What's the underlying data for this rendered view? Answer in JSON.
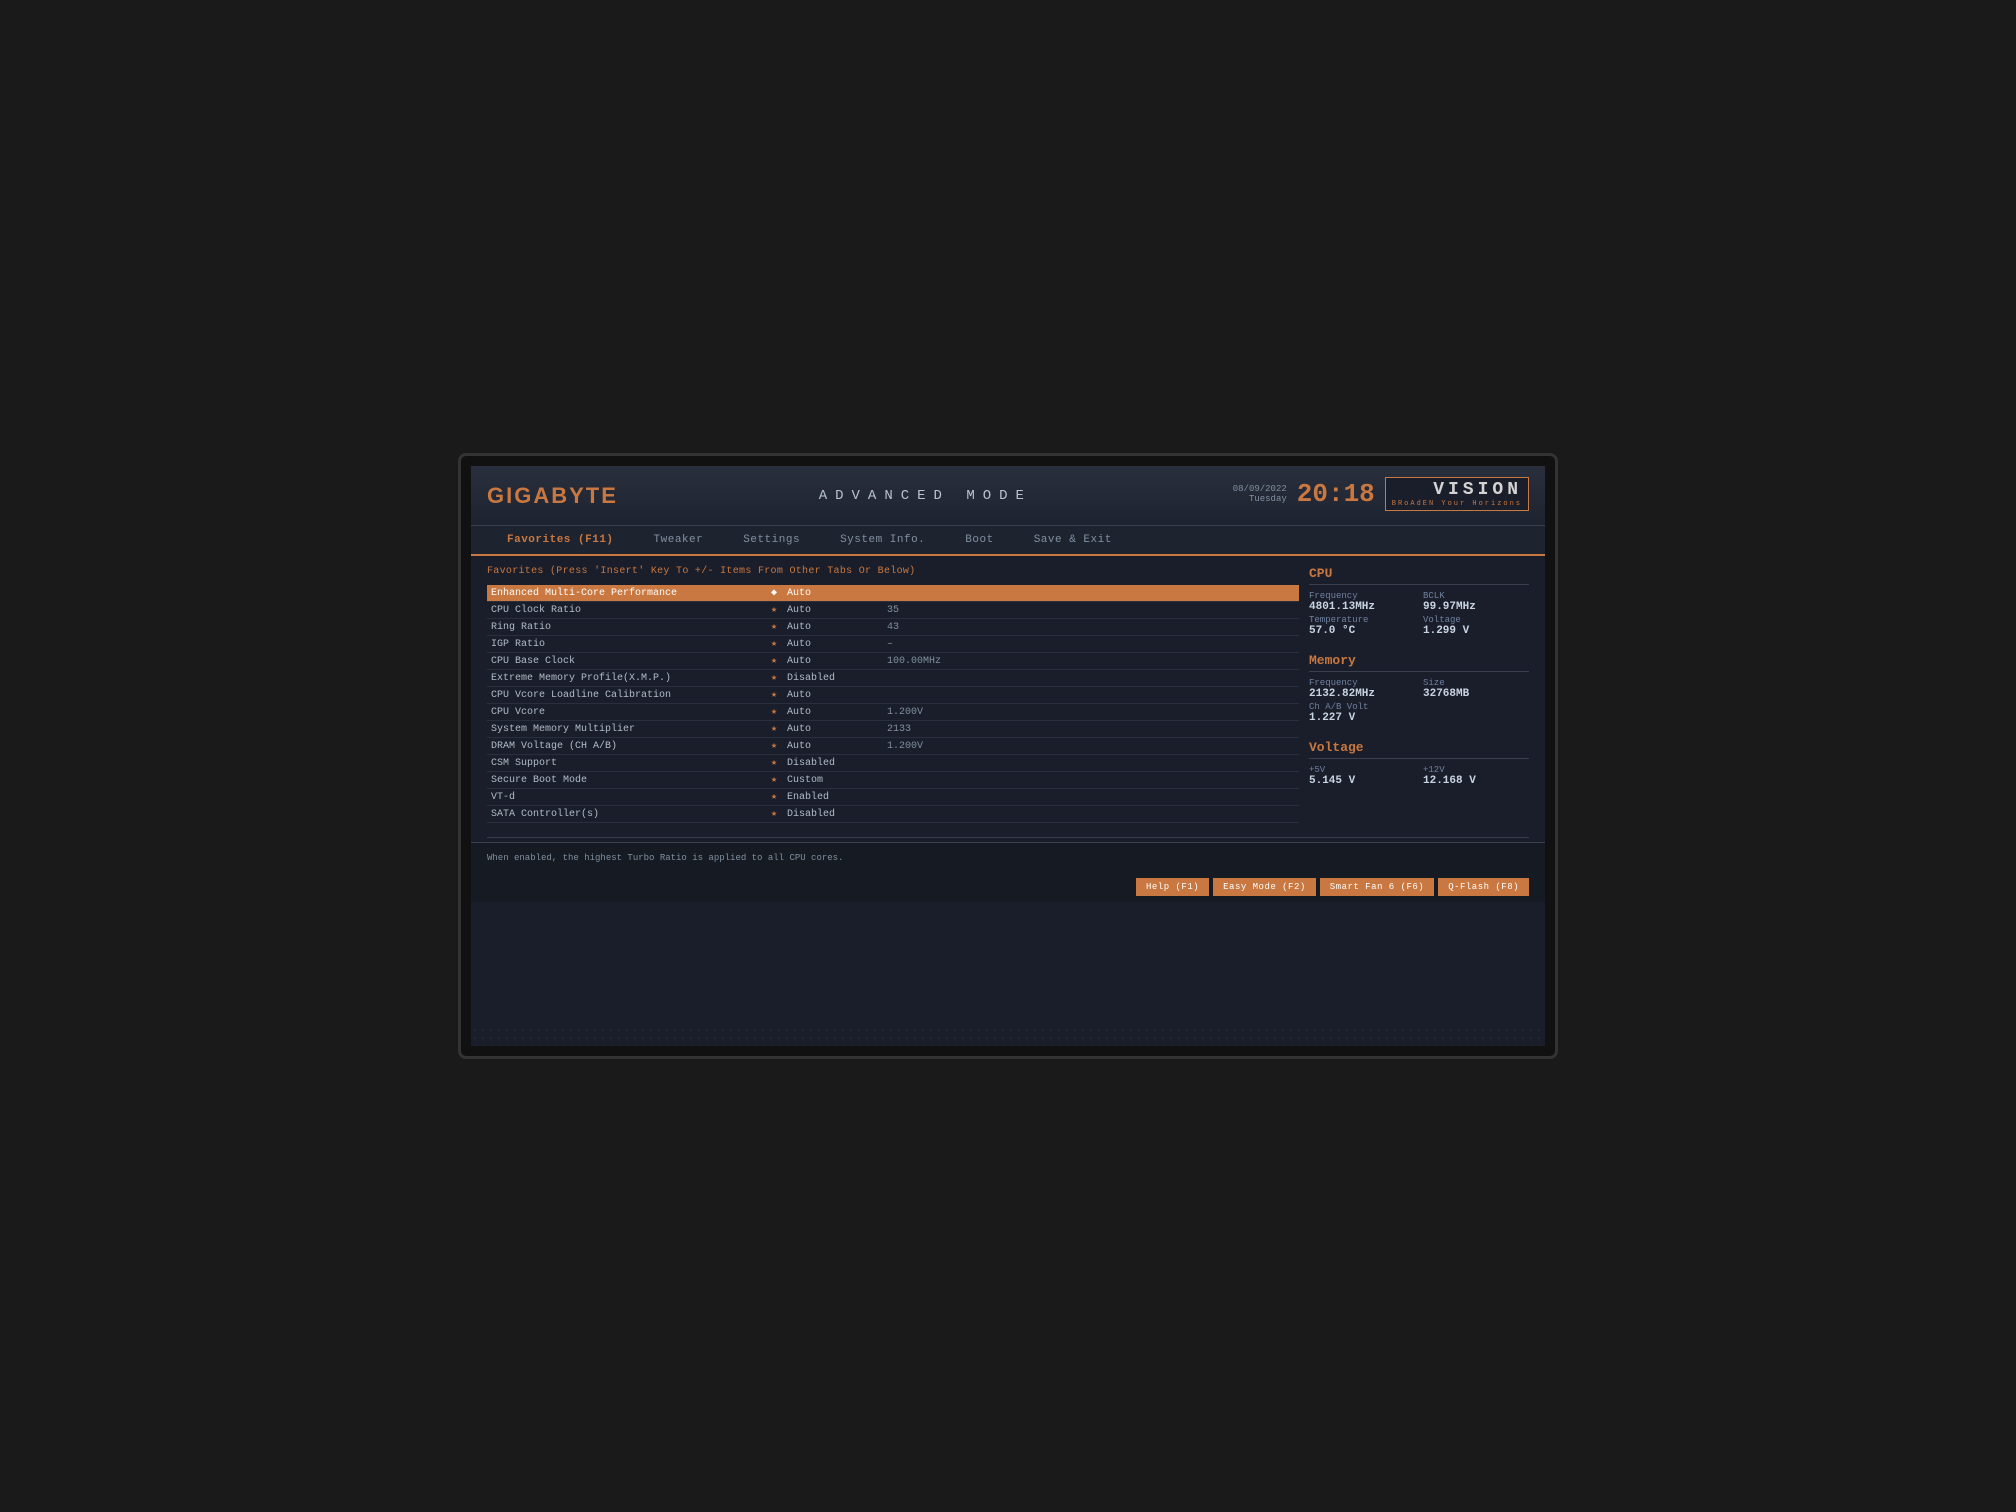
{
  "header": {
    "logo": "GIGABYTE",
    "mode_title": "ADVANCED  MODE",
    "date": "08/09/2022",
    "day": "Tuesday",
    "time": "20:18",
    "vision_text": "VISION",
    "vision_tagline": "BRoAdEN Your Horizons"
  },
  "nav": {
    "tabs": [
      {
        "label": "Favorites (F11)",
        "active": true
      },
      {
        "label": "Tweaker",
        "active": false
      },
      {
        "label": "Settings",
        "active": false
      },
      {
        "label": "System Info.",
        "active": false
      },
      {
        "label": "Boot",
        "active": false
      },
      {
        "label": "Save & Exit",
        "active": false
      }
    ]
  },
  "main": {
    "favorites_header": "Favorites (Press 'Insert' Key To +/- Items From Other Tabs Or Below)",
    "rows": [
      {
        "name": "Enhanced Multi-Core Performance",
        "star": true,
        "value": "Auto",
        "extra": "",
        "highlighted": true
      },
      {
        "name": "CPU Clock Ratio",
        "star": true,
        "value": "Auto",
        "extra": "35",
        "highlighted": false
      },
      {
        "name": "Ring Ratio",
        "star": true,
        "value": "Auto",
        "extra": "43",
        "highlighted": false
      },
      {
        "name": "IGP Ratio",
        "star": true,
        "value": "Auto",
        "extra": "–",
        "highlighted": false
      },
      {
        "name": "CPU Base Clock",
        "star": true,
        "value": "Auto",
        "extra": "100.00MHz",
        "highlighted": false
      },
      {
        "name": "Extreme Memory Profile(X.M.P.)",
        "star": true,
        "value": "Disabled",
        "extra": "",
        "highlighted": false
      },
      {
        "name": "CPU Vcore Loadline Calibration",
        "star": true,
        "value": "Auto",
        "extra": "",
        "highlighted": false
      },
      {
        "name": "CPU Vcore",
        "star": true,
        "value": "Auto",
        "extra": "1.200V",
        "highlighted": false
      },
      {
        "name": "System Memory Multiplier",
        "star": true,
        "value": "Auto",
        "extra": "2133",
        "highlighted": false
      },
      {
        "name": "DRAM Voltage    (CH A/B)",
        "star": true,
        "value": "Auto",
        "extra": "1.200V",
        "highlighted": false
      },
      {
        "name": "CSM Support",
        "star": true,
        "value": "Disabled",
        "extra": "",
        "highlighted": false
      },
      {
        "name": "Secure Boot Mode",
        "star": true,
        "value": "Custom",
        "extra": "",
        "highlighted": false
      },
      {
        "name": "VT-d",
        "star": true,
        "value": "Enabled",
        "extra": "",
        "highlighted": false
      },
      {
        "name": "SATA Controller(s)",
        "star": true,
        "value": "Disabled",
        "extra": "",
        "highlighted": false
      }
    ]
  },
  "sidebar": {
    "cpu_section": {
      "title": "CPU",
      "frequency_label": "Frequency",
      "frequency_value": "4801.13MHz",
      "bclk_label": "BCLK",
      "bclk_value": "99.97MHz",
      "temperature_label": "Temperature",
      "temperature_value": "57.0 °C",
      "voltage_label": "Voltage",
      "voltage_value": "1.299 V"
    },
    "memory_section": {
      "title": "Memory",
      "frequency_label": "Frequency",
      "frequency_value": "2132.82MHz",
      "size_label": "Size",
      "size_value": "32768MB",
      "ch_volt_label": "Ch A/B Volt",
      "ch_volt_value": "1.227 V"
    },
    "voltage_section": {
      "title": "Voltage",
      "plus5v_label": "+5V",
      "plus5v_value": "5.145 V",
      "plus12v_label": "+12V",
      "plus12v_value": "12.168 V"
    }
  },
  "bottom": {
    "help_text": "When enabled, the highest Turbo Ratio is applied to all CPU cores.",
    "buttons": [
      {
        "label": "Help (F1)"
      },
      {
        "label": "Easy Mode (F2)"
      },
      {
        "label": "Smart Fan 6 (F6)"
      },
      {
        "label": "Q-Flash (F8)"
      }
    ]
  }
}
